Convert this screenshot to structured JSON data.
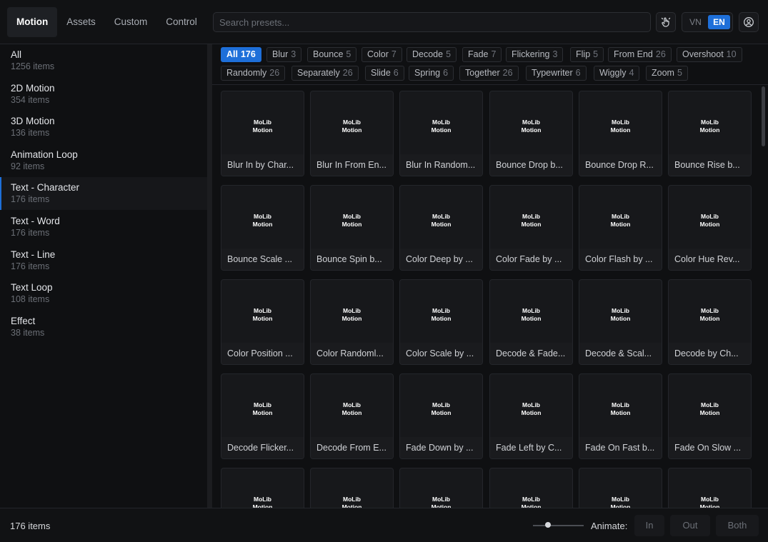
{
  "tabs": [
    {
      "label": "Motion"
    },
    {
      "label": "Assets"
    },
    {
      "label": "Custom"
    },
    {
      "label": "Control"
    }
  ],
  "search": {
    "placeholder": "Search presets..."
  },
  "language": {
    "options": [
      "VN",
      "EN"
    ],
    "selected": "EN"
  },
  "icons": {
    "effects_button": "tap-hand-icon",
    "account_button": "user-circle-icon"
  },
  "accent_color": "#1e6fd9",
  "sidebar": {
    "items": [
      {
        "label": "All",
        "count": "1256 items"
      },
      {
        "label": "2D Motion",
        "count": "354 items"
      },
      {
        "label": "3D Motion",
        "count": "136 items"
      },
      {
        "label": "Animation Loop",
        "count": "92 items"
      },
      {
        "label": "Text - Character",
        "count": "176 items"
      },
      {
        "label": "Text - Word",
        "count": "176 items"
      },
      {
        "label": "Text - Line",
        "count": "176 items"
      },
      {
        "label": "Text Loop",
        "count": "108 items"
      },
      {
        "label": "Effect",
        "count": "38 items"
      }
    ],
    "selected": "Text - Character"
  },
  "filters": [
    {
      "label": "All",
      "count": "176"
    },
    {
      "label": "Blur",
      "count": "3"
    },
    {
      "label": "Bounce",
      "count": "5"
    },
    {
      "label": "Color",
      "count": "7"
    },
    {
      "label": "Decode",
      "count": "5"
    },
    {
      "label": "Fade",
      "count": "7"
    },
    {
      "label": "Flickering",
      "count": "3"
    },
    {
      "label": "Flip",
      "count": "5"
    },
    {
      "label": "From End",
      "count": "26"
    },
    {
      "label": "Overshoot",
      "count": "10"
    },
    {
      "label": "Randomly",
      "count": "26"
    },
    {
      "label": "Separately",
      "count": "26"
    },
    {
      "label": "Slide",
      "count": "6"
    },
    {
      "label": "Spring",
      "count": "6"
    },
    {
      "label": "Together",
      "count": "26"
    },
    {
      "label": "Typewriter",
      "count": "6"
    },
    {
      "label": "Wiggly",
      "count": "4"
    },
    {
      "label": "Zoom",
      "count": "5"
    }
  ],
  "preview_logo": {
    "line1": "MoLib",
    "line2": "Motion"
  },
  "presets": [
    "Blur In by Char...",
    "Blur In From En...",
    "Blur In Random...",
    "Bounce Drop b...",
    "Bounce Drop R...",
    "Bounce Rise b...",
    "Bounce Scale ...",
    "Bounce Spin b...",
    "Color Deep by ...",
    "Color Fade by ...",
    "Color Flash by ...",
    "Color Hue Rev...",
    "Color Position ...",
    "Color Randoml...",
    "Color Scale by ...",
    "Decode & Fade...",
    "Decode & Scal...",
    "Decode by Ch...",
    "Decode Flicker...",
    "Decode From E...",
    "Fade Down by ...",
    "Fade Left by C...",
    "Fade On Fast b...",
    "Fade On Slow ...",
    "",
    "",
    "",
    "",
    "",
    ""
  ],
  "footer": {
    "count": "176 items",
    "animate_label": "Animate:",
    "slider_value": 0.3,
    "buttons": [
      "In",
      "Out",
      "Both"
    ]
  }
}
